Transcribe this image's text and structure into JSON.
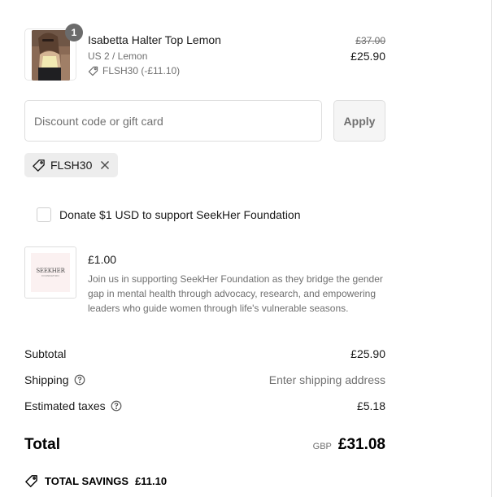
{
  "product": {
    "title": "Isabetta Halter Top Lemon",
    "variant": "US 2 / Lemon",
    "discount_line": "FLSH30 (-£11.10)",
    "quantity": "1",
    "original_price": "£37.00",
    "price": "£25.90"
  },
  "discount": {
    "placeholder": "Discount code or gift card",
    "apply_label": "Apply",
    "applied_code": "FLSH30"
  },
  "donation": {
    "checkbox_label": "Donate $1 USD to support SeekHer Foundation",
    "checked": false,
    "price": "£1.00",
    "description": "Join us in supporting SeekHer Foundation as they bridge the gender gap in mental health through advocacy, research, and empowering leaders who guide women through life's vulnerable seasons.",
    "logo_text": "SEEKHER",
    "logo_subtext": "FOUNDATION"
  },
  "summary": {
    "subtotal_label": "Subtotal",
    "subtotal_value": "£25.90",
    "shipping_label": "Shipping",
    "shipping_value": "Enter shipping address",
    "taxes_label": "Estimated taxes",
    "taxes_value": "£5.18",
    "total_label": "Total",
    "currency": "GBP",
    "total_value": "£31.08",
    "savings_label": "TOTAL SAVINGS",
    "savings_value": "£11.10"
  },
  "icons": {
    "tag": "tag-icon",
    "close": "close-icon",
    "help": "help-circle-icon",
    "savings": "price-tag-icon"
  },
  "colors": {
    "badge": "#6b6b6b",
    "muted_text": "#707070",
    "chip_bg": "#ededed",
    "apply_bg": "#f5f5f5"
  }
}
